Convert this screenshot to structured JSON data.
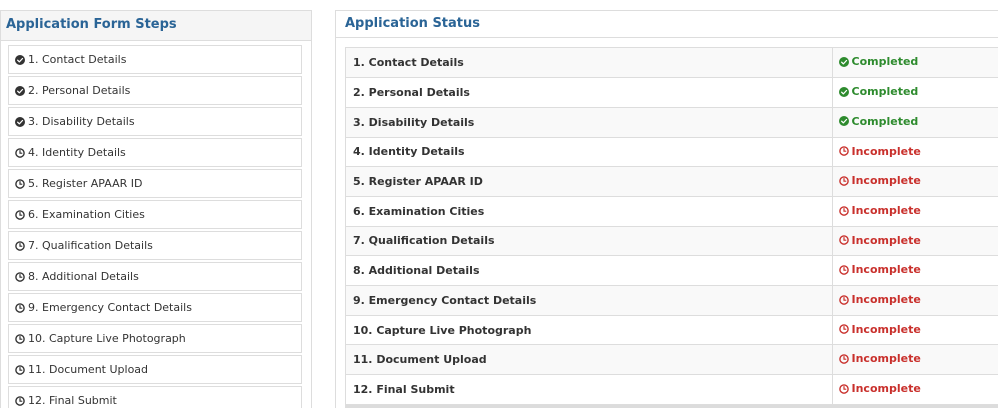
{
  "left_panel": {
    "title": "Application Form Steps",
    "steps": [
      {
        "label": "1. Contact Details",
        "done": true
      },
      {
        "label": "2. Personal Details",
        "done": true
      },
      {
        "label": "3. Disability Details",
        "done": true
      },
      {
        "label": "4. Identity Details",
        "done": false
      },
      {
        "label": "5. Register APAAR ID",
        "done": false
      },
      {
        "label": "6. Examination Cities",
        "done": false
      },
      {
        "label": "7. Qualification Details",
        "done": false
      },
      {
        "label": "8. Additional Details",
        "done": false
      },
      {
        "label": "9. Emergency Contact Details",
        "done": false
      },
      {
        "label": "10. Capture Live Photograph",
        "done": false
      },
      {
        "label": "11. Document Upload",
        "done": false
      },
      {
        "label": "12. Final Submit",
        "done": false
      }
    ]
  },
  "right_panel": {
    "title": "Application Status",
    "rows": [
      {
        "step": "1. Contact Details",
        "status": "Completed"
      },
      {
        "step": "2. Personal Details",
        "status": "Completed"
      },
      {
        "step": "3. Disability Details",
        "status": "Completed"
      },
      {
        "step": "4. Identity Details",
        "status": "Incomplete"
      },
      {
        "step": "5. Register APAAR ID",
        "status": "Incomplete"
      },
      {
        "step": "6. Examination Cities",
        "status": "Incomplete"
      },
      {
        "step": "7. Qualification Details",
        "status": "Incomplete"
      },
      {
        "step": "8. Additional Details",
        "status": "Incomplete"
      },
      {
        "step": "9. Emergency Contact Details",
        "status": "Incomplete"
      },
      {
        "step": "10. Capture Live Photograph",
        "status": "Incomplete"
      },
      {
        "step": "11. Document Upload",
        "status": "Incomplete"
      },
      {
        "step": "12. Final Submit",
        "status": "Incomplete"
      }
    ]
  },
  "colors": {
    "heading": "#2a6496",
    "completed": "#2e8b2e",
    "incomplete": "#c9302c"
  },
  "icons": {
    "done": "check-circle-icon",
    "pending": "clock-icon"
  }
}
